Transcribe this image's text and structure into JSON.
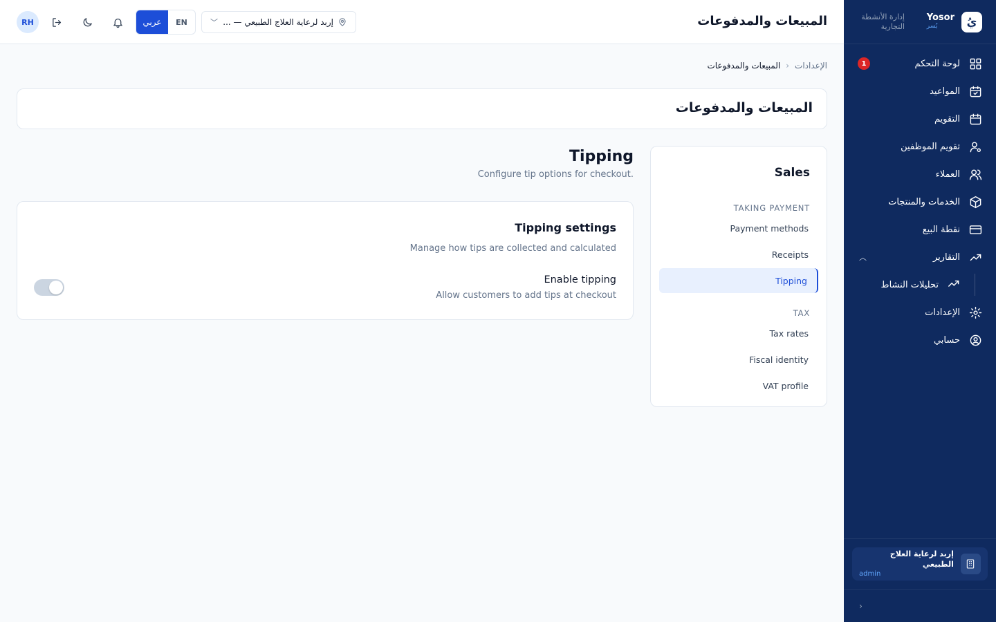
{
  "sidebar": {
    "brand_en": "Yosor",
    "brand_ar": "يُسر",
    "brand_logo": "يُ",
    "brand_tagline": "إدارة الأنشطة التجارية",
    "items": [
      {
        "label": "لوحة التحكم",
        "icon": "dashboard-grid-icon",
        "badge": "1"
      },
      {
        "label": "المواعيد",
        "icon": "calendar-check-icon"
      },
      {
        "label": "التقويم",
        "icon": "calendar-icon"
      },
      {
        "label": "تقويم الموظفين",
        "icon": "user-gear-icon"
      },
      {
        "label": "العملاء",
        "icon": "users-icon"
      },
      {
        "label": "الخدمات والمنتجات",
        "icon": "box-icon"
      },
      {
        "label": "نقطة البيع",
        "icon": "credit-card-icon"
      },
      {
        "label": "التقارير",
        "icon": "trend-up-icon"
      }
    ],
    "sub_item": {
      "label": "تحليلات النشاط",
      "icon": "trend-up-icon"
    },
    "items_after": [
      {
        "label": "الإعدادات",
        "icon": "gear-icon"
      },
      {
        "label": "حسابي",
        "icon": "user-circle-icon"
      }
    ],
    "org_name": "إربد لرعاية العلاج الطبيعي",
    "org_role": "admin"
  },
  "topbar": {
    "title": "المبيعات والمدفوعات",
    "avatar": "RH",
    "lang_ar": "عربي",
    "lang_en": "EN",
    "location": "إربد لرعاية العلاج الطبيعي — ..."
  },
  "breadcrumb": {
    "parent": "الإعدادات",
    "current": "المبيعات والمدفوعات"
  },
  "page_title": "المبيعات والمدفوعات",
  "sales_menu": {
    "heading": "Sales",
    "section1": "TAKING PAYMENT",
    "links1": [
      "Payment methods",
      "Receipts",
      "Tipping"
    ],
    "section2": "TAX",
    "links2": [
      "Tax rates",
      "Fiscal identity",
      "VAT profile"
    ],
    "active": "Tipping"
  },
  "tipping": {
    "title": "Tipping",
    "subtitle": "Configure tip options for checkout.",
    "card_title": "Tipping settings",
    "card_desc": "Manage how tips are collected and calculated",
    "enable_label": "Enable tipping",
    "enable_desc": "Allow customers to add tips at checkout",
    "enabled": false
  },
  "colors": {
    "sidebar": "#0f2a5f",
    "accent": "#1d4ed8",
    "badge": "#dc2626"
  }
}
